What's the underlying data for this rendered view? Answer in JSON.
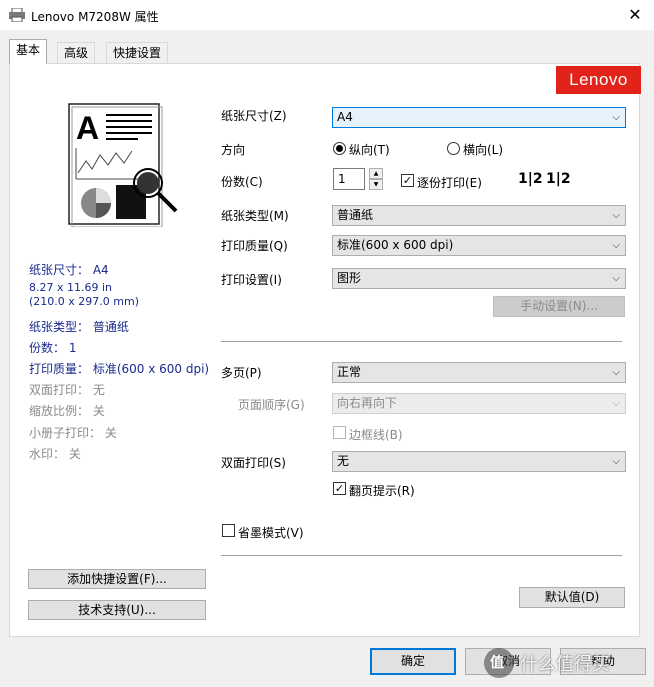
{
  "window": {
    "title": "Lenovo M7208W 属性",
    "close": "✕"
  },
  "tabs": [
    {
      "label": "基本"
    },
    {
      "label": "高级"
    },
    {
      "label": "快捷设置"
    }
  ],
  "brand": {
    "logo_text": "Lenovo",
    "color": "#e2231a"
  },
  "summary": {
    "paper_size": "纸张尺寸： A4",
    "paper_dim1": "8.27 x 11.69 in",
    "paper_dim2": "(210.0 x 297.0 mm)",
    "media_type": "纸张类型： 普通纸",
    "copies": "份数： 1",
    "quality": "打印质量： 标准(600 x 600 dpi)",
    "duplex": "双面打印： 无",
    "scaling": "缩放比例： 关",
    "booklet": "小册子打印： 关",
    "watermark": "水印： 关"
  },
  "left_buttons": {
    "add_quick": "添加快捷设置(F)...",
    "support": "技术支持(U)..."
  },
  "form": {
    "paper_size_label": "纸张尺寸(Z)",
    "paper_size_value": "A4",
    "orientation_label": "方向",
    "portrait": "纵向(T)",
    "landscape": "横向(L)",
    "copies_label": "份数(C)",
    "copies_value": "1",
    "collate": "逐份打印(E)",
    "collate_icon_a": "1|2",
    "collate_icon_b": "1|2",
    "media_label": "纸张类型(M)",
    "media_value": "普通纸",
    "quality_label": "打印质量(Q)",
    "quality_value": "标准(600 x 600 dpi)",
    "print_settings_label": "打印设置(I)",
    "print_settings_value": "图形",
    "manual_button": "手动设置(N)...",
    "multipage_label": "多页(P)",
    "multipage_value": "正常",
    "page_order_label": "页面顺序(G)",
    "page_order_value": "向右再向下",
    "border_label": "边框线(B)",
    "duplex_label": "双面打印(S)",
    "duplex_value": "无",
    "flip_hint": "翻页提示(R)",
    "toner_save": "省墨模式(V)",
    "defaults_button": "默认值(D)"
  },
  "footer": {
    "ok": "确定",
    "cancel": "取消",
    "help": "帮助"
  },
  "watermark_text": "值 什么值得买"
}
